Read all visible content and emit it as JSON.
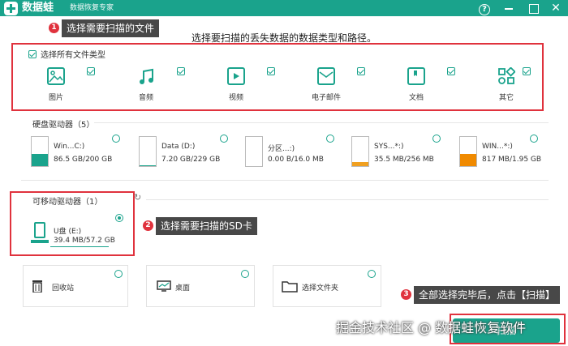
{
  "app": {
    "name": "数据蛙",
    "subtitle": "数据恢复专家"
  },
  "heading": "选择要扫描的丢失数据的数据类型和路径。",
  "file_types": {
    "select_all_label": "选择所有文件类型",
    "items": [
      {
        "label": "图片",
        "icon": "image-icon",
        "checked": true
      },
      {
        "label": "音频",
        "icon": "music-icon",
        "checked": true
      },
      {
        "label": "视频",
        "icon": "video-icon",
        "checked": true
      },
      {
        "label": "电子邮件",
        "icon": "mail-icon",
        "checked": true
      },
      {
        "label": "文档",
        "icon": "document-icon",
        "checked": true
      },
      {
        "label": "其它",
        "icon": "other-icon",
        "checked": true
      }
    ]
  },
  "hard_drives": {
    "label": "硬盘驱动器（5）",
    "items": [
      {
        "name": "Win...C:)",
        "size": "86.5 GB/200 GB",
        "used_fraction": 0.43,
        "color": "#1aa38c"
      },
      {
        "name": "Data (D:)",
        "size": "7.20 GB/229 GB",
        "used_fraction": 0.03,
        "color": "#1aa38c"
      },
      {
        "name": "分区...:)",
        "size": "0.00 B/16.0 MB",
        "used_fraction": 0.0,
        "color": "#1aa38c"
      },
      {
        "name": "SYS...*:)",
        "size": "35.5 MB/256 MB",
        "used_fraction": 0.14,
        "color": "#f0a020"
      },
      {
        "name": "WIN...*:)",
        "size": "817 MB/1.95 GB",
        "used_fraction": 0.41,
        "color": "#f08a00"
      }
    ]
  },
  "removable": {
    "label": "可移动驱动器（1）",
    "items": [
      {
        "name": "U盘 (E:)",
        "size": "39.4 MB/57.2 GB",
        "used_fraction": 0.01,
        "selected": true
      }
    ]
  },
  "locations": [
    {
      "label": "回收站",
      "icon": "recycle-bin-icon"
    },
    {
      "label": "桌面",
      "icon": "desktop-icon"
    },
    {
      "label": "选择文件夹",
      "icon": "folder-icon"
    }
  ],
  "annotations": [
    {
      "number": "1",
      "text": "选择需要扫描的文件"
    },
    {
      "number": "2",
      "text": "选择需要扫描的SD卡"
    },
    {
      "number": "3",
      "text": "全部选择完毕后，点击【扫描】"
    }
  ],
  "scan_button": "扫描",
  "watermark": "掘金技术社区 @ 数据蛙恢复软件",
  "colors": {
    "accent": "#1aa38c",
    "annotation_red": "#e0323d"
  }
}
